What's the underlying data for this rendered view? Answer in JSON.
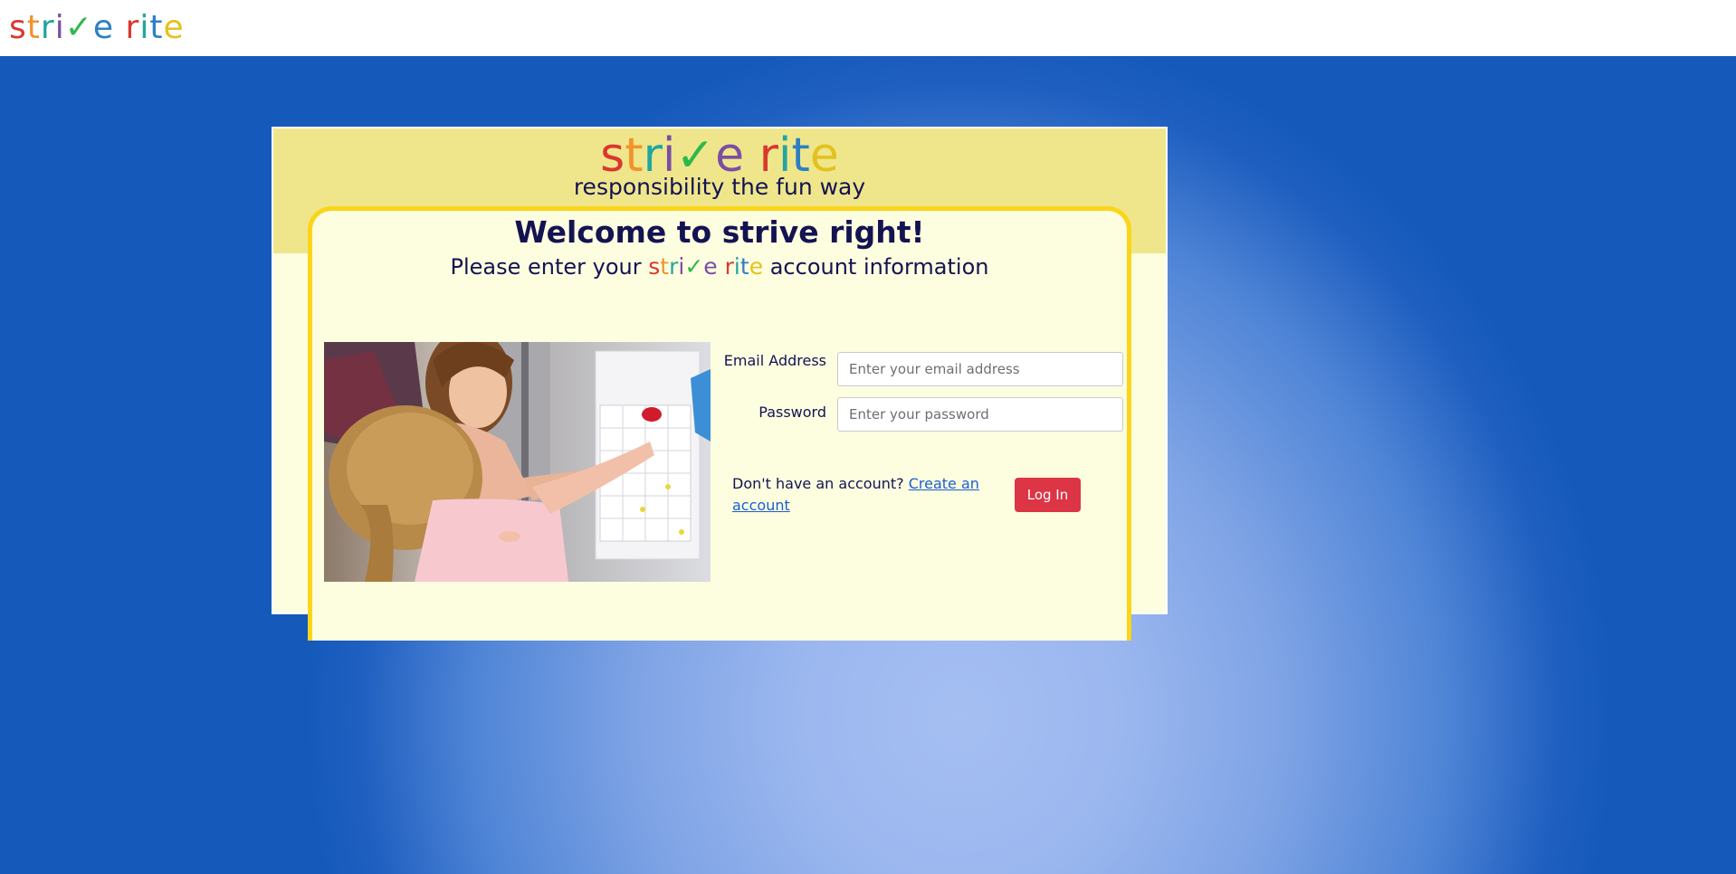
{
  "header": {
    "logo_text": "strive rite"
  },
  "card": {
    "logo_text": "strive rite",
    "tagline": "responsibility the fun way",
    "welcome": "Welcome to strive right!",
    "please_prefix": "Please enter your",
    "please_logo": "strive rite",
    "please_suffix": "account information"
  },
  "form": {
    "email_label": "Email Address",
    "email_placeholder": "Enter your email address",
    "password_label": "Password",
    "password_placeholder": "Enter your password",
    "no_account_text": "Don't have an account?",
    "create_account_link": "Create an account",
    "login_button": "Log In"
  },
  "colors": {
    "logo_letters": [
      "#d8392f",
      "#f0932b",
      "#23a5a0",
      "#7b4ea3",
      "#2db84d",
      "#2d7fc4",
      "#e3c21f"
    ],
    "button": "#dc3545",
    "heading_text": "#141352",
    "band": "#efe68c",
    "panel_border": "#fbd51a"
  },
  "photo": {
    "description_icon": "mother-child-chore-chart-photo"
  }
}
